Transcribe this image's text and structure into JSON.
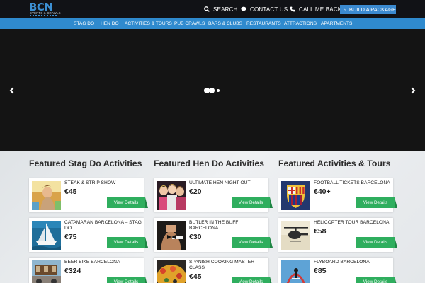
{
  "header": {
    "logo_text": "BCN",
    "logo_subtitle": "EVENTS & CRAWLS",
    "search_label": "SEARCH",
    "contact_label": "CONTACT US",
    "call_label": "CALL ME BACK",
    "build_label": "BUILD A PACKAGE"
  },
  "nav": {
    "items": [
      "STAG DO",
      "HEN DO",
      "ACTIVITIES & TOURS",
      "PUB CRAWLS",
      "BARS & CLUBS",
      "RESTAURANTS",
      "ATTRACTIONS",
      "APARTMENTS"
    ]
  },
  "slider": {
    "dots": 3,
    "active_dot": 2
  },
  "columns": [
    {
      "title": "Featured Stag Do Activities",
      "cards": [
        {
          "title": "STEAK & STRIP SHOW",
          "price": "€45",
          "button": "View Details",
          "image": "show-performer-image"
        },
        {
          "title": "CATAMARAN BARCELONA – STAG DO",
          "price": "€75",
          "button": "View Details",
          "image": "catamaran-image"
        },
        {
          "title": "BEER BIKE BARCELONA",
          "price": "€324",
          "button": "View Details",
          "image": "beer-bike-image"
        }
      ]
    },
    {
      "title": "Featured Hen Do Activities",
      "cards": [
        {
          "title": "ULTIMATE HEN NIGHT OUT",
          "price": "€20",
          "button": "View Details",
          "image": "hen-party-image"
        },
        {
          "title": "BUTLER IN THE BUFF BARCELONA",
          "price": "€30",
          "button": "View Details",
          "image": "butler-image"
        },
        {
          "title": "SPANISH COOKING MASTER CLASS",
          "price": "€45",
          "button": "View Details",
          "image": "paella-image"
        }
      ]
    },
    {
      "title": "Featured Activities & Tours",
      "cards": [
        {
          "title": "FOOTBALL TICKETS BARCELONA",
          "price": "€40+",
          "button": "View Details",
          "image": "fc-barcelona-crest-image"
        },
        {
          "title": "HELICOPTER TOUR BARCELONA",
          "price": "€58",
          "button": "View Details",
          "image": "helicopter-image"
        },
        {
          "title": "FLYBOARD BARCELONA",
          "price": "€85",
          "button": "View Details",
          "image": "flyboard-image"
        }
      ]
    }
  ],
  "colors": {
    "topbar": "#111216",
    "nav_blue": "#2f8ace",
    "button_green": "#2fae5e",
    "hero": "#141414"
  }
}
